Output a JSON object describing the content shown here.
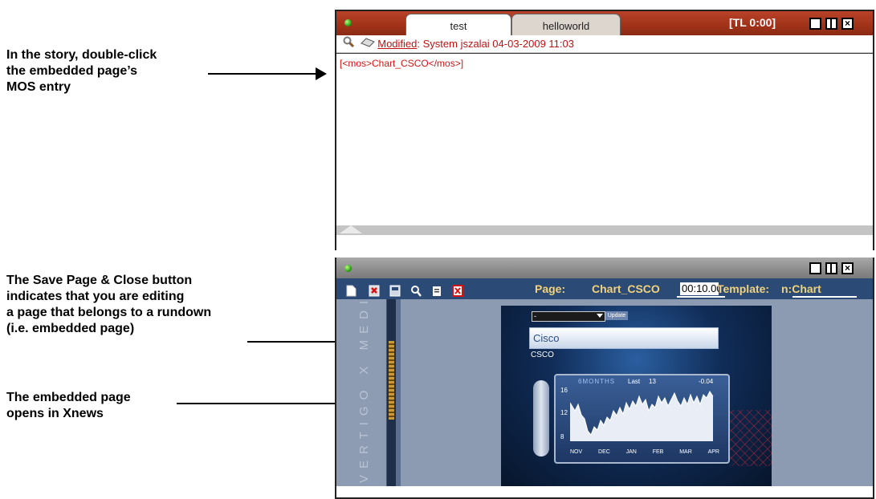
{
  "callouts": [
    {
      "lines": [
        "In the story, double-click",
        "the embedded page’s",
        "MOS entry"
      ]
    },
    {
      "lines": [
        "The Save Page & Close button",
        "indicates that you are editing",
        "a page that belongs to a rundown",
        "(i.e. embedded page)"
      ]
    },
    {
      "lines": [
        "The embedded page",
        "opens in Xnews"
      ]
    }
  ],
  "story_window": {
    "tabs": [
      {
        "label": "test",
        "active": true
      },
      {
        "label": "helloworld",
        "active": false
      }
    ],
    "timer": "[TL 0:00]",
    "modified_link": "Modified",
    "modified_info": ": System jszalai   04-03-2009 11:03",
    "mos_entry": "[<mos>Chart_CSCO</mos>]"
  },
  "page_editor": {
    "page_label": "Page:",
    "page_name": "Chart_CSCO",
    "duration": "00:10.00",
    "template_label": "Template:",
    "template_name": "n:Chart",
    "vertical_logo": "VERTIGO X MEDIA",
    "preview": {
      "dropdown_value": "-",
      "update_button": "Update",
      "company": "Cisco",
      "ticker": "CSCO",
      "period": "6MONTHS",
      "last_label": "Last",
      "last_value": "13",
      "change": "-0.04",
      "y_ticks": [
        "16",
        "12",
        "8"
      ],
      "x_ticks": [
        "NOV",
        "DEC",
        "JAN",
        "FEB",
        "MAR",
        "APR"
      ]
    }
  },
  "colors": {
    "titlebar_red": "#a03218",
    "toolbar_blue": "#2b4a75",
    "mos_red": "#d61212",
    "label_gold": "#f2d27a"
  }
}
